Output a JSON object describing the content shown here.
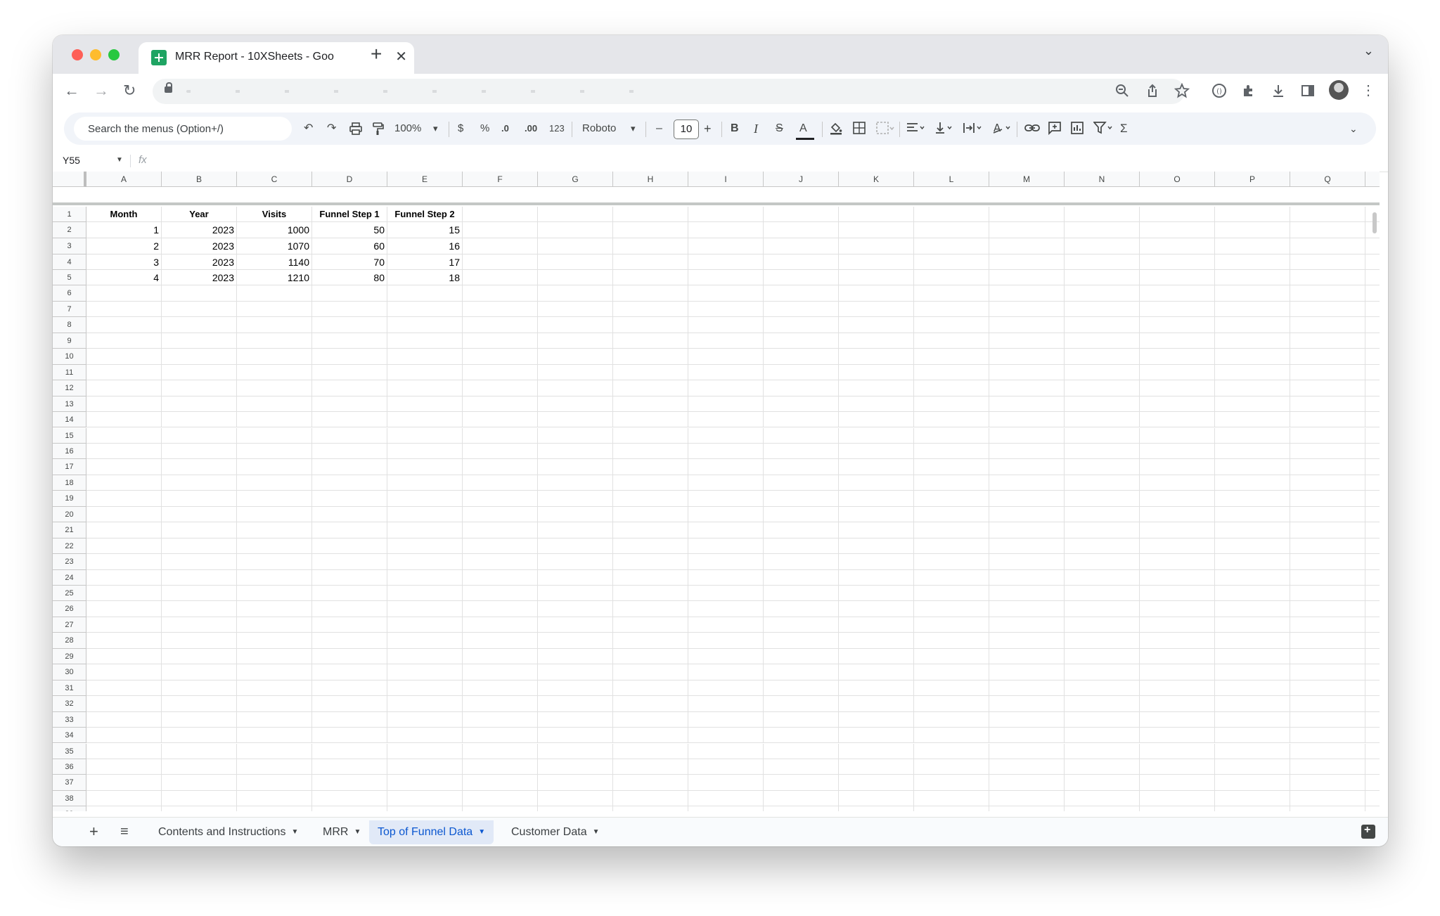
{
  "browser": {
    "tab_title": "MRR Report - 10XSheets - Goo",
    "close_glyph": "✕",
    "newtab_glyph": "+",
    "tabmenu_glyph": "⌄"
  },
  "toolbar": {
    "search_placeholder": "Search the menus (Option+/)",
    "zoom": "100%",
    "currency": "$",
    "percent": "%",
    "dec_decrease": ".0",
    "dec_increase": ".00",
    "number_format": "123",
    "font": "Roboto",
    "font_size": "10",
    "bold": "B",
    "italic": "I",
    "strike": "S",
    "text_color": "A",
    "sum": "Σ"
  },
  "formula_bar": {
    "name_box": "Y55",
    "fx": "fx"
  },
  "sheet": {
    "columns": [
      "A",
      "B",
      "C",
      "D",
      "E",
      "F",
      "G",
      "H",
      "I",
      "J",
      "K",
      "L",
      "M",
      "N",
      "O",
      "P",
      "Q"
    ],
    "header_row": [
      "Month",
      "Year",
      "Visits",
      "Funnel Step 1",
      "Funnel Step 2"
    ],
    "data_rows": [
      [
        "1",
        "2023",
        "1000",
        "50",
        "15"
      ],
      [
        "2",
        "2023",
        "1070",
        "60",
        "16"
      ],
      [
        "3",
        "2023",
        "1140",
        "70",
        "17"
      ],
      [
        "4",
        "2023",
        "1210",
        "80",
        "18"
      ]
    ],
    "row_count": 39
  },
  "sheet_tabs": [
    {
      "label": "Contents and Instructions",
      "active": false
    },
    {
      "label": "MRR",
      "active": false
    },
    {
      "label": "Top of Funnel Data",
      "active": true
    },
    {
      "label": "Customer Data",
      "active": false
    }
  ],
  "colors": {
    "active_tab_bg": "#e1e9f7",
    "active_tab_text": "#0b57d0",
    "sheets_green": "#1fa463"
  }
}
